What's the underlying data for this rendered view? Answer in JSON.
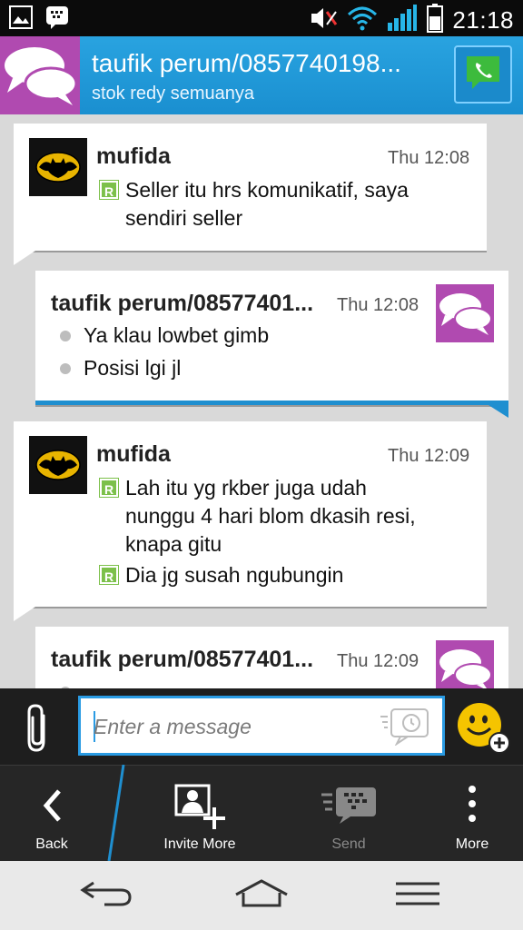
{
  "status_bar": {
    "time": "21:18",
    "icons": [
      "gallery-icon",
      "bbm-notification-icon",
      "mute-icon",
      "wifi-icon",
      "signal-icon",
      "battery-icon"
    ]
  },
  "header": {
    "title": "taufik perum/0857740198...",
    "subtitle": "stok redy semuanya",
    "call_icon": "phone-icon",
    "color": "#1f9ad8"
  },
  "messages": [
    {
      "sender": "mufida",
      "time": "Thu 12:08",
      "direction": "incoming",
      "lines": [
        "Seller itu hrs komunikatif, saya",
        "sendiri seller"
      ],
      "marker": "R"
    },
    {
      "sender": "taufik perum/08577401...",
      "time": "Thu 12:08",
      "direction": "outgoing",
      "items": [
        "Ya klau lowbet gimb",
        "Posisi lgi jl"
      ]
    },
    {
      "sender": "mufida",
      "time": "Thu 12:09",
      "direction": "incoming",
      "lines": [
        "Lah itu yg rkber juga udah",
        "nunggu 4 hari blom dkasih resi,",
        "knapa gitu"
      ],
      "lines2": [
        "Dia jg susah ngubungin"
      ],
      "marker": "R"
    },
    {
      "sender": "taufik perum/08577401...",
      "time": "Thu 12:09",
      "direction": "outgoing"
    }
  ],
  "compose": {
    "placeholder": "Enter a message"
  },
  "actions": [
    {
      "label": "Back",
      "icon": "back-chevron-icon",
      "enabled": true
    },
    {
      "label": "Invite More",
      "icon": "invite-contact-icon",
      "enabled": true
    },
    {
      "label": "Send",
      "icon": "send-bbm-icon",
      "enabled": false
    },
    {
      "label": "More",
      "icon": "overflow-menu-icon",
      "enabled": true
    }
  ],
  "navigation": [
    "back-arrow-icon",
    "home-icon",
    "menu-icon"
  ]
}
